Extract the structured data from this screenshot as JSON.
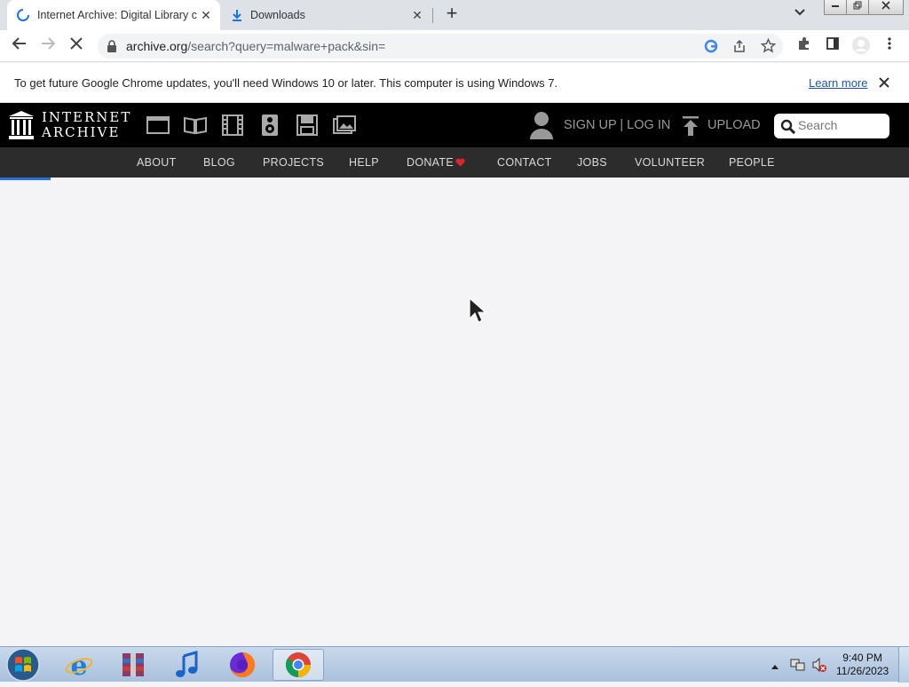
{
  "browser": {
    "tabs": [
      {
        "title": "Internet Archive: Digital Library c"
      },
      {
        "title": "Downloads"
      }
    ],
    "new_tab_symbol": "+",
    "tab_close_symbol": "✕",
    "url_host": "archive.org",
    "url_path": "/search?query=malware+pack&sin=",
    "infobar": {
      "message": "To get future Google Chrome updates, you'll need Windows 10 or later. This computer is using Windows 7.",
      "link": "Learn more"
    }
  },
  "ia": {
    "logo_line1": "INTERNET",
    "logo_line2": "ARCHIVE",
    "media_icons": [
      "web-icon",
      "texts-icon",
      "video-icon",
      "audio-icon",
      "software-icon",
      "images-icon"
    ],
    "account": "SIGN UP | LOG IN",
    "upload": "UPLOAD",
    "search_placeholder": "Search",
    "nav": [
      "ABOUT",
      "BLOG",
      "PROJECTS",
      "HELP",
      "DONATE",
      "CONTACT",
      "JOBS",
      "VOLUNTEER",
      "PEOPLE"
    ],
    "donate_heart_color": "#e0242e"
  },
  "taskbar": {
    "apps": [
      "internet-explorer-icon",
      "winrar-icon",
      "itunes-icon",
      "firefox-icon",
      "chrome-icon"
    ],
    "time": "9:40 PM",
    "date": "11/26/2023"
  },
  "colors": {
    "accent_blue": "#2a72d5",
    "ia_black": "#000000",
    "ia_nav": "#2c2c2c"
  }
}
